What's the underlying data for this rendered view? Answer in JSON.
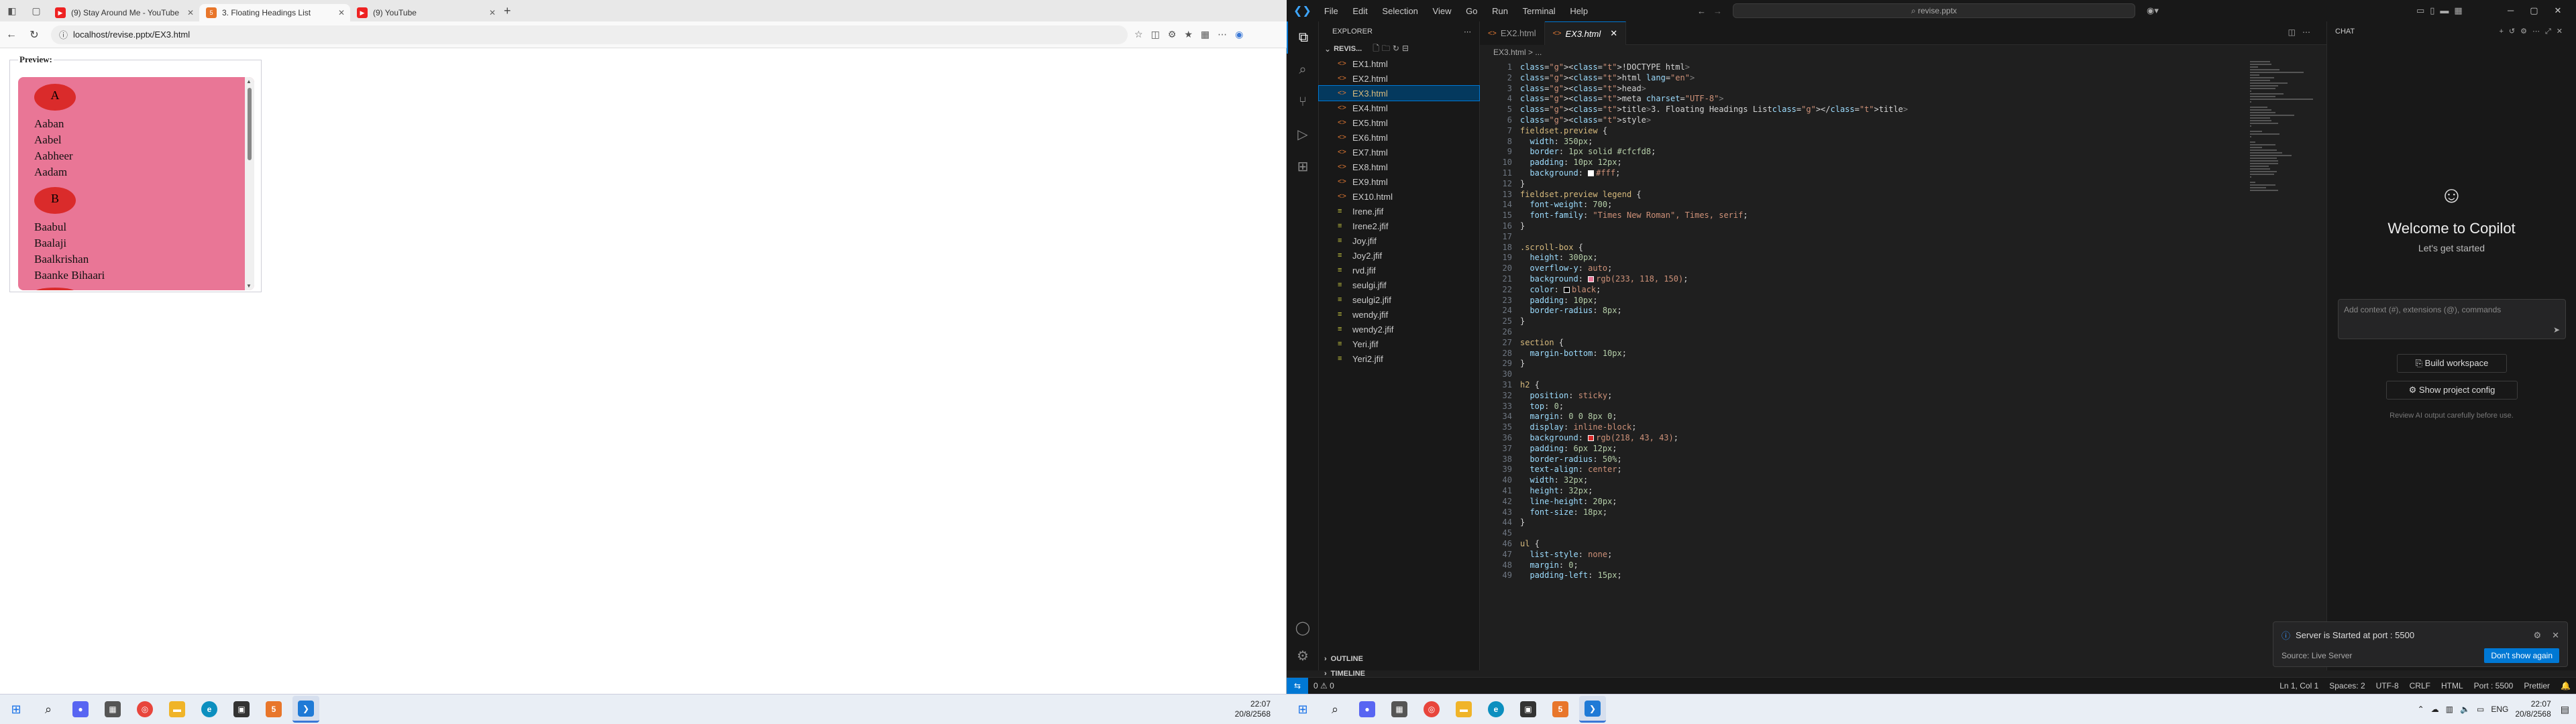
{
  "browser": {
    "tabs": [
      {
        "label": "(9) Stay Around Me - YouTube",
        "icon": "youtube-icon",
        "active": false
      },
      {
        "label": "3. Floating Headings List",
        "icon": "html-icon",
        "active": true
      },
      {
        "label": "(9) YouTube",
        "icon": "youtube-icon",
        "active": false
      }
    ],
    "url": "localhost/revise.pptx/EX3.html",
    "preview_legend": "Preview:",
    "sections": [
      {
        "heading": "A",
        "names": [
          "Aaban",
          "Aabel",
          "Aabheer",
          "Aadam"
        ]
      },
      {
        "heading": "B",
        "names": [
          "Baabul",
          "Baalaji",
          "Baalkrishan",
          "Baanke Bihaari"
        ]
      }
    ]
  },
  "taskbar_left": {
    "time": "22:07",
    "date": "20/8/2568"
  },
  "vscode": {
    "menu": [
      "File",
      "Edit",
      "Selection",
      "View",
      "Go",
      "Run",
      "Terminal",
      "Help"
    ],
    "search": "revise.pptx",
    "explorer_title": "EXPLORER",
    "folder": "REVIS...",
    "files": [
      {
        "name": "EX1.html",
        "type": "html"
      },
      {
        "name": "EX2.html",
        "type": "html"
      },
      {
        "name": "EX3.html",
        "type": "html",
        "selected": true
      },
      {
        "name": "EX4.html",
        "type": "html"
      },
      {
        "name": "EX5.html",
        "type": "html"
      },
      {
        "name": "EX6.html",
        "type": "html"
      },
      {
        "name": "EX7.html",
        "type": "html"
      },
      {
        "name": "EX8.html",
        "type": "html"
      },
      {
        "name": "EX9.html",
        "type": "html"
      },
      {
        "name": "EX10.html",
        "type": "html"
      },
      {
        "name": "Irene.jfif",
        "type": "img"
      },
      {
        "name": "Irene2.jfif",
        "type": "img"
      },
      {
        "name": "Joy.jfif",
        "type": "img"
      },
      {
        "name": "Joy2.jfif",
        "type": "img"
      },
      {
        "name": "rvd.jfif",
        "type": "img"
      },
      {
        "name": "seulgi.jfif",
        "type": "img"
      },
      {
        "name": "seulgi2.jfif",
        "type": "img"
      },
      {
        "name": "wendy.jfif",
        "type": "img"
      },
      {
        "name": "wendy2.jfif",
        "type": "img"
      },
      {
        "name": "Yeri.jfif",
        "type": "img"
      },
      {
        "name": "Yeri2.jfif",
        "type": "img"
      }
    ],
    "outline": "OUTLINE",
    "timeline": "TIMELINE",
    "editor_tabs": [
      {
        "label": "EX2.html",
        "active": false
      },
      {
        "label": "EX3.html",
        "active": true
      }
    ],
    "breadcrumb": "EX3.html > ...",
    "code_lines": [
      "<!DOCTYPE html>",
      "<html lang=\"en\">",
      "<head>",
      "<meta charset=\"UTF-8\">",
      "<title>3. Floating Headings List</title>",
      "<style>",
      "fieldset.preview {",
      "  width: 350px;",
      "  border: 1px solid #cfcfd8;",
      "  padding: 10px 12px;",
      "  background: #fff;",
      "}",
      "fieldset.preview legend {",
      "  font-weight: 700;",
      "  font-family: \"Times New Roman\", Times, serif;",
      "}",
      "",
      ".scroll-box {",
      "  height: 300px;",
      "  overflow-y: auto;",
      "  background: rgb(233, 118, 150);",
      "  color: black;",
      "  padding: 10px;",
      "  border-radius: 8px;",
      "}",
      "",
      "section {",
      "  margin-bottom: 10px;",
      "}",
      "",
      "h2 {",
      "  position: sticky;",
      "  top: 0;",
      "  margin: 0 0 8px 0;",
      "  display: inline-block;",
      "  background: rgb(218, 43, 43);",
      "  padding: 6px 12px;",
      "  border-radius: 50%;",
      "  text-align: center;",
      "  width: 32px;",
      "  height: 32px;",
      "  line-height: 20px;",
      "  font-size: 18px;",
      "}",
      "",
      "ul {",
      "  list-style: none;",
      "  margin: 0;",
      "  padding-left: 15px;"
    ],
    "chat": {
      "header": "CHAT",
      "title": "Welcome to Copilot",
      "subtitle": "Let's get started",
      "input_placeholder": "Add context (#), extensions (@), commands",
      "build_workspace": "Build workspace",
      "show_config": "Show project config",
      "disclaimer": "Review AI output carefully before use."
    },
    "toast": {
      "message": "Server is Started at port : 5500",
      "source": "Source: Live Server",
      "button": "Don't show again"
    },
    "status": {
      "problems": "0 ⚠ 0",
      "position": "Ln 1, Col 1",
      "spaces": "Spaces: 2",
      "encoding": "UTF-8",
      "eol": "CRLF",
      "language": "HTML",
      "port": "Port : 5500",
      "prettier": "Prettier"
    }
  },
  "taskbar_right": {
    "lang": "ENG",
    "time": "22:07",
    "date": "20/8/2568"
  },
  "colors": {
    "scroll_bg": "#e97696",
    "badge_bg": "#da2b2b",
    "vscode_accent": "#0078d4"
  }
}
